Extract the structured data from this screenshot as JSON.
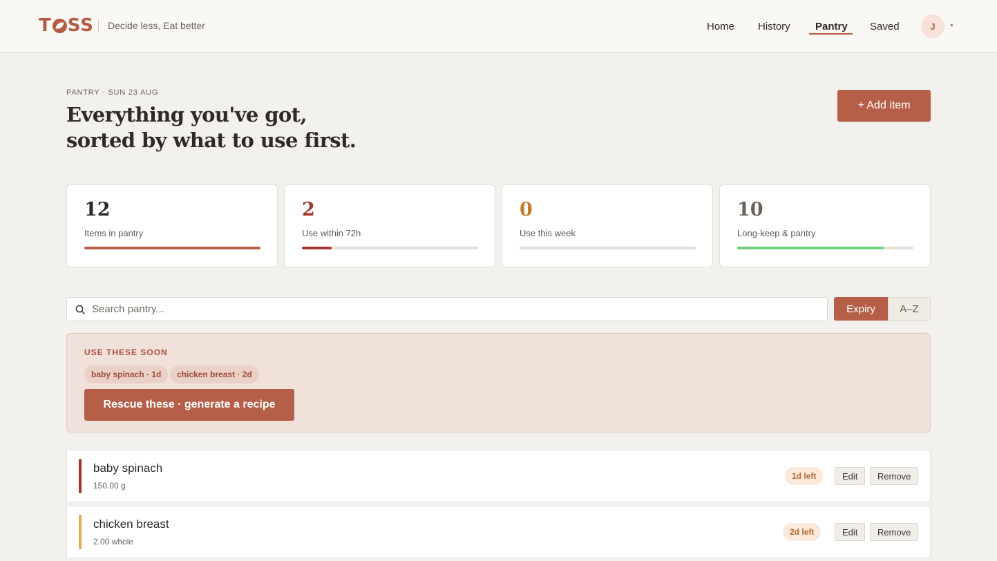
{
  "brand": {
    "logo_pre": "T",
    "logo_post": "SS",
    "tagline": "Decide less, Eat better",
    "accent": "#b55a43"
  },
  "nav": {
    "links": [
      "Home",
      "History",
      "Pantry",
      "Saved"
    ],
    "active": "Pantry",
    "avatar_initial": "J"
  },
  "header": {
    "eyebrow": "PANTRY · SUN 23 AUG",
    "title_line1": "Everything you've got,",
    "title_line2": "sorted by what to use first.",
    "add_label": "+ Add item"
  },
  "stats": [
    {
      "value": "12",
      "label": "Items in pantry",
      "color": "#2f2a27",
      "bar_color": "#b55f48",
      "fill": 1.0
    },
    {
      "value": "2",
      "label": "Use within 72h",
      "color": "#a3362c",
      "bar_color": "#a3362c",
      "fill": 0.17
    },
    {
      "value": "0",
      "label": "Use this week",
      "color": "#c47a2c",
      "bar_color": "#c47a2c",
      "fill": 0.0
    },
    {
      "value": "10",
      "label": "Long-keep & pantry",
      "color": "#6a625b",
      "bar_color": "#6fcf7b",
      "fill": 0.83
    }
  ],
  "search": {
    "placeholder": "Search pantry..."
  },
  "sort": {
    "options": [
      "Expiry",
      "A–Z"
    ],
    "selected": "Expiry"
  },
  "soon": {
    "title": "USE THESE SOON",
    "chips": [
      "baby spinach · 1d",
      "chicken breast · 2d"
    ],
    "rescue_label": "Rescue these · generate a recipe"
  },
  "items": [
    {
      "name": "baby spinach",
      "qty": "150.00 g",
      "days": "1d left",
      "accent": "#a3362c",
      "edit": "Edit",
      "remove": "Remove"
    },
    {
      "name": "chicken breast",
      "qty": "2.00 whole",
      "days": "2d left",
      "accent": "#e0ae4a",
      "edit": "Edit",
      "remove": "Remove"
    }
  ]
}
